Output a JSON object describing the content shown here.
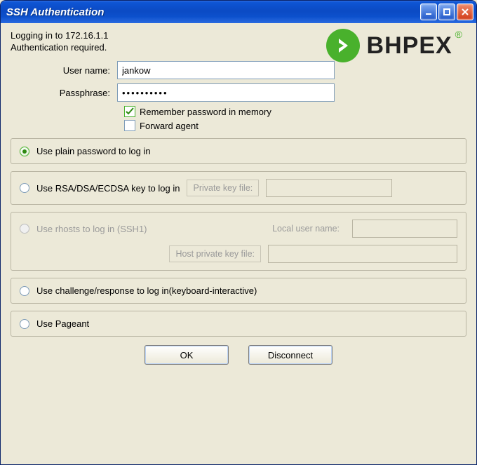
{
  "title": "SSH Authentication",
  "logo": {
    "text": "BHPEX",
    "reg": "®"
  },
  "info": {
    "line1": "Logging in to 172.16.1.1",
    "line2": "Authentication required."
  },
  "form": {
    "username_label": "User name:",
    "username_value": "jankow",
    "passphrase_label": "Passphrase:",
    "passphrase_value": "••••••••••",
    "remember_label": "Remember password in memory",
    "remember_checked": true,
    "forward_label": "Forward agent",
    "forward_checked": false
  },
  "methods": {
    "plain": "Use plain password to log in",
    "rsa": "Use RSA/DSA/ECDSA key to log in",
    "rsa_keyfile_label": "Private key file:",
    "rhosts": "Use rhosts to log in (SSH1)",
    "rhosts_local_label": "Local user name:",
    "rhosts_hostkey_label": "Host private key file:",
    "challenge": "Use challenge/response to log in(keyboard-interactive)",
    "pageant": "Use Pageant"
  },
  "buttons": {
    "ok": "OK",
    "disconnect": "Disconnect"
  }
}
